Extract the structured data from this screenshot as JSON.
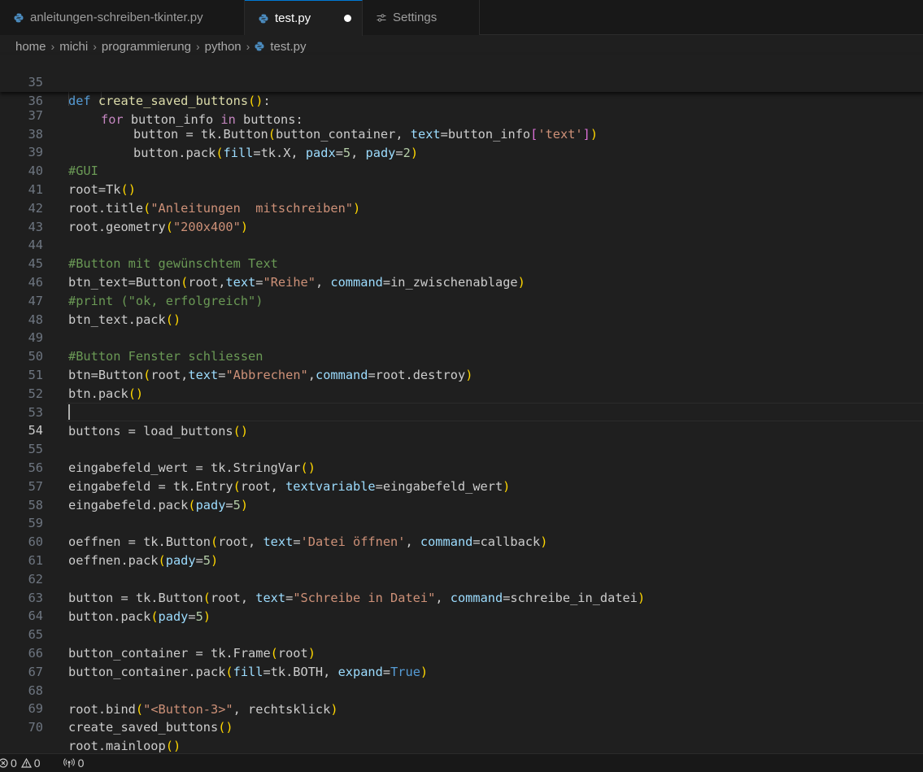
{
  "tabs": [
    {
      "label": "anleitungen-schreiben-tkinter.py",
      "icon": "python-file-icon",
      "active": false
    },
    {
      "label": "test.py",
      "icon": "python-file-icon",
      "active": true,
      "modified": true
    },
    {
      "label": "Settings",
      "icon": "settings-sliders-icon",
      "active": false
    }
  ],
  "breadcrumb": [
    "home",
    "michi",
    "programmierung",
    "python",
    "test.py"
  ],
  "sticky_lines": [
    {
      "num": "35"
    },
    {
      "num": "36"
    }
  ],
  "lines": [
    {
      "num": "37"
    },
    {
      "num": "38"
    },
    {
      "num": "39"
    },
    {
      "num": "40"
    },
    {
      "num": "41"
    },
    {
      "num": "42"
    },
    {
      "num": "43"
    },
    {
      "num": "44"
    },
    {
      "num": "45"
    },
    {
      "num": "46"
    },
    {
      "num": "47"
    },
    {
      "num": "48"
    },
    {
      "num": "49"
    },
    {
      "num": "50"
    },
    {
      "num": "51"
    },
    {
      "num": "52"
    },
    {
      "num": "53"
    },
    {
      "num": "54"
    },
    {
      "num": "55"
    },
    {
      "num": "56"
    },
    {
      "num": "57"
    },
    {
      "num": "58"
    },
    {
      "num": "59"
    },
    {
      "num": "60"
    },
    {
      "num": "61"
    },
    {
      "num": "62"
    },
    {
      "num": "63"
    },
    {
      "num": "64"
    },
    {
      "num": "65"
    },
    {
      "num": "66"
    },
    {
      "num": "67"
    },
    {
      "num": "68"
    },
    {
      "num": "69"
    },
    {
      "num": "70"
    }
  ],
  "code": {
    "l35": {
      "def": "def",
      "name": "create_saved_buttons",
      "open": "(",
      "close": ")",
      "colon": ":"
    },
    "l36": {
      "for": "for",
      "var": " button_info ",
      "in": "in",
      "rest": " buttons:"
    },
    "l37": {
      "a": "button = tk.Button",
      "open": "(",
      "b": "button_container, ",
      "p": "text",
      "eq": "=button_info",
      "br": "[",
      "s": "'text'",
      "brc": "]",
      "close": ")"
    },
    "l38": {
      "a": "button.pack",
      "open": "(",
      "p1": "fill",
      "b": "=tk.X, ",
      "p2": "padx",
      "eq2": "=",
      "n1": "5",
      "comma": ", ",
      "p3": "pady",
      "eq3": "=",
      "n2": "2",
      "close": ")"
    },
    "l39": {
      "c": "#GUI"
    },
    "l40": {
      "a": "root=Tk",
      "open": "(",
      "close": ")"
    },
    "l41": {
      "a": "root.title",
      "open": "(",
      "s": "\"Anleitungen  mitschreiben\"",
      "close": ")"
    },
    "l42": {
      "a": "root.geometry",
      "open": "(",
      "s": "\"200x400\"",
      "close": ")"
    },
    "l44": {
      "c": "#Button mit gewünschtem Text"
    },
    "l45": {
      "a": "btn_text=Button",
      "open": "(",
      "b": "root,",
      "p1": "text",
      "eq1": "=",
      "s": "\"Reihe\"",
      "comma": ", ",
      "p2": "command",
      "rest": "=in_zwischenablage",
      "close": ")"
    },
    "l46": {
      "c": "#print (\"ok, erfolgreich\")"
    },
    "l47": {
      "a": "btn_text.pack",
      "open": "(",
      "close": ")"
    },
    "l49": {
      "c": "#Button Fenster schliessen"
    },
    "l50": {
      "a": "btn=Button",
      "open": "(",
      "b": "root,",
      "p1": "text",
      "eq1": "=",
      "s": "\"Abbrechen\"",
      "comma": ",",
      "p2": "command",
      "rest": "=root.destroy",
      "close": ")"
    },
    "l51": {
      "a": "btn.pack",
      "open": "(",
      "close": ")"
    },
    "l53": {
      "a": "buttons = load_buttons",
      "open": "(",
      "close": ")"
    },
    "l55": {
      "a": "eingabefeld_wert = tk.StringVar",
      "open": "(",
      "close": ")"
    },
    "l56": {
      "a": "eingabefeld = tk.Entry",
      "open": "(",
      "b": "root, ",
      "p": "textvariable",
      "rest": "=eingabefeld_wert",
      "close": ")"
    },
    "l57": {
      "a": "eingabefeld.pack",
      "open": "(",
      "p": "pady",
      "eq": "=",
      "n": "5",
      "close": ")"
    },
    "l59": {
      "a": "oeffnen = tk.Button",
      "open": "(",
      "b": "root, ",
      "p1": "text",
      "eq1": "=",
      "s": "'Datei öffnen'",
      "comma": ", ",
      "p2": "command",
      "rest": "=callback",
      "close": ")"
    },
    "l60": {
      "a": "oeffnen.pack",
      "open": "(",
      "p": "pady",
      "eq": "=",
      "n": "5",
      "close": ")"
    },
    "l62": {
      "a": "button = tk.Button",
      "open": "(",
      "b": "root, ",
      "p1": "text",
      "eq1": "=",
      "s": "\"Schreibe in Datei\"",
      "comma": ", ",
      "p2": "command",
      "rest": "=schreibe_in_datei",
      "close": ")"
    },
    "l63": {
      "a": "button.pack",
      "open": "(",
      "p": "pady",
      "eq": "=",
      "n": "5",
      "close": ")"
    },
    "l65": {
      "a": "button_container = tk.Frame",
      "open": "(",
      "b": "root",
      "close": ")"
    },
    "l66": {
      "a": "button_container.pack",
      "open": "(",
      "p1": "fill",
      "b": "=tk.BOTH, ",
      "p2": "expand",
      "eq2": "=",
      "k": "True",
      "close": ")"
    },
    "l68": {
      "a": "root.bind",
      "open": "(",
      "s": "\"<Button-3>\"",
      "rest": ", rechtsklick",
      "close": ")"
    },
    "l69": {
      "a": "create_saved_buttons",
      "open": "(",
      "close": ")"
    },
    "l70": {
      "a": "root.mainloop",
      "open": "(",
      "close": ")"
    }
  },
  "status": {
    "errors": "0",
    "warnings": "0",
    "ports": "0"
  },
  "colors": {
    "keyword": "#569cd6",
    "control": "#c586c0",
    "string": "#ce9178",
    "param": "#9cdcfe",
    "number": "#b5cea8",
    "comment": "#6a9955",
    "bracket": "#ffd700",
    "function": "#dcdcaa"
  }
}
